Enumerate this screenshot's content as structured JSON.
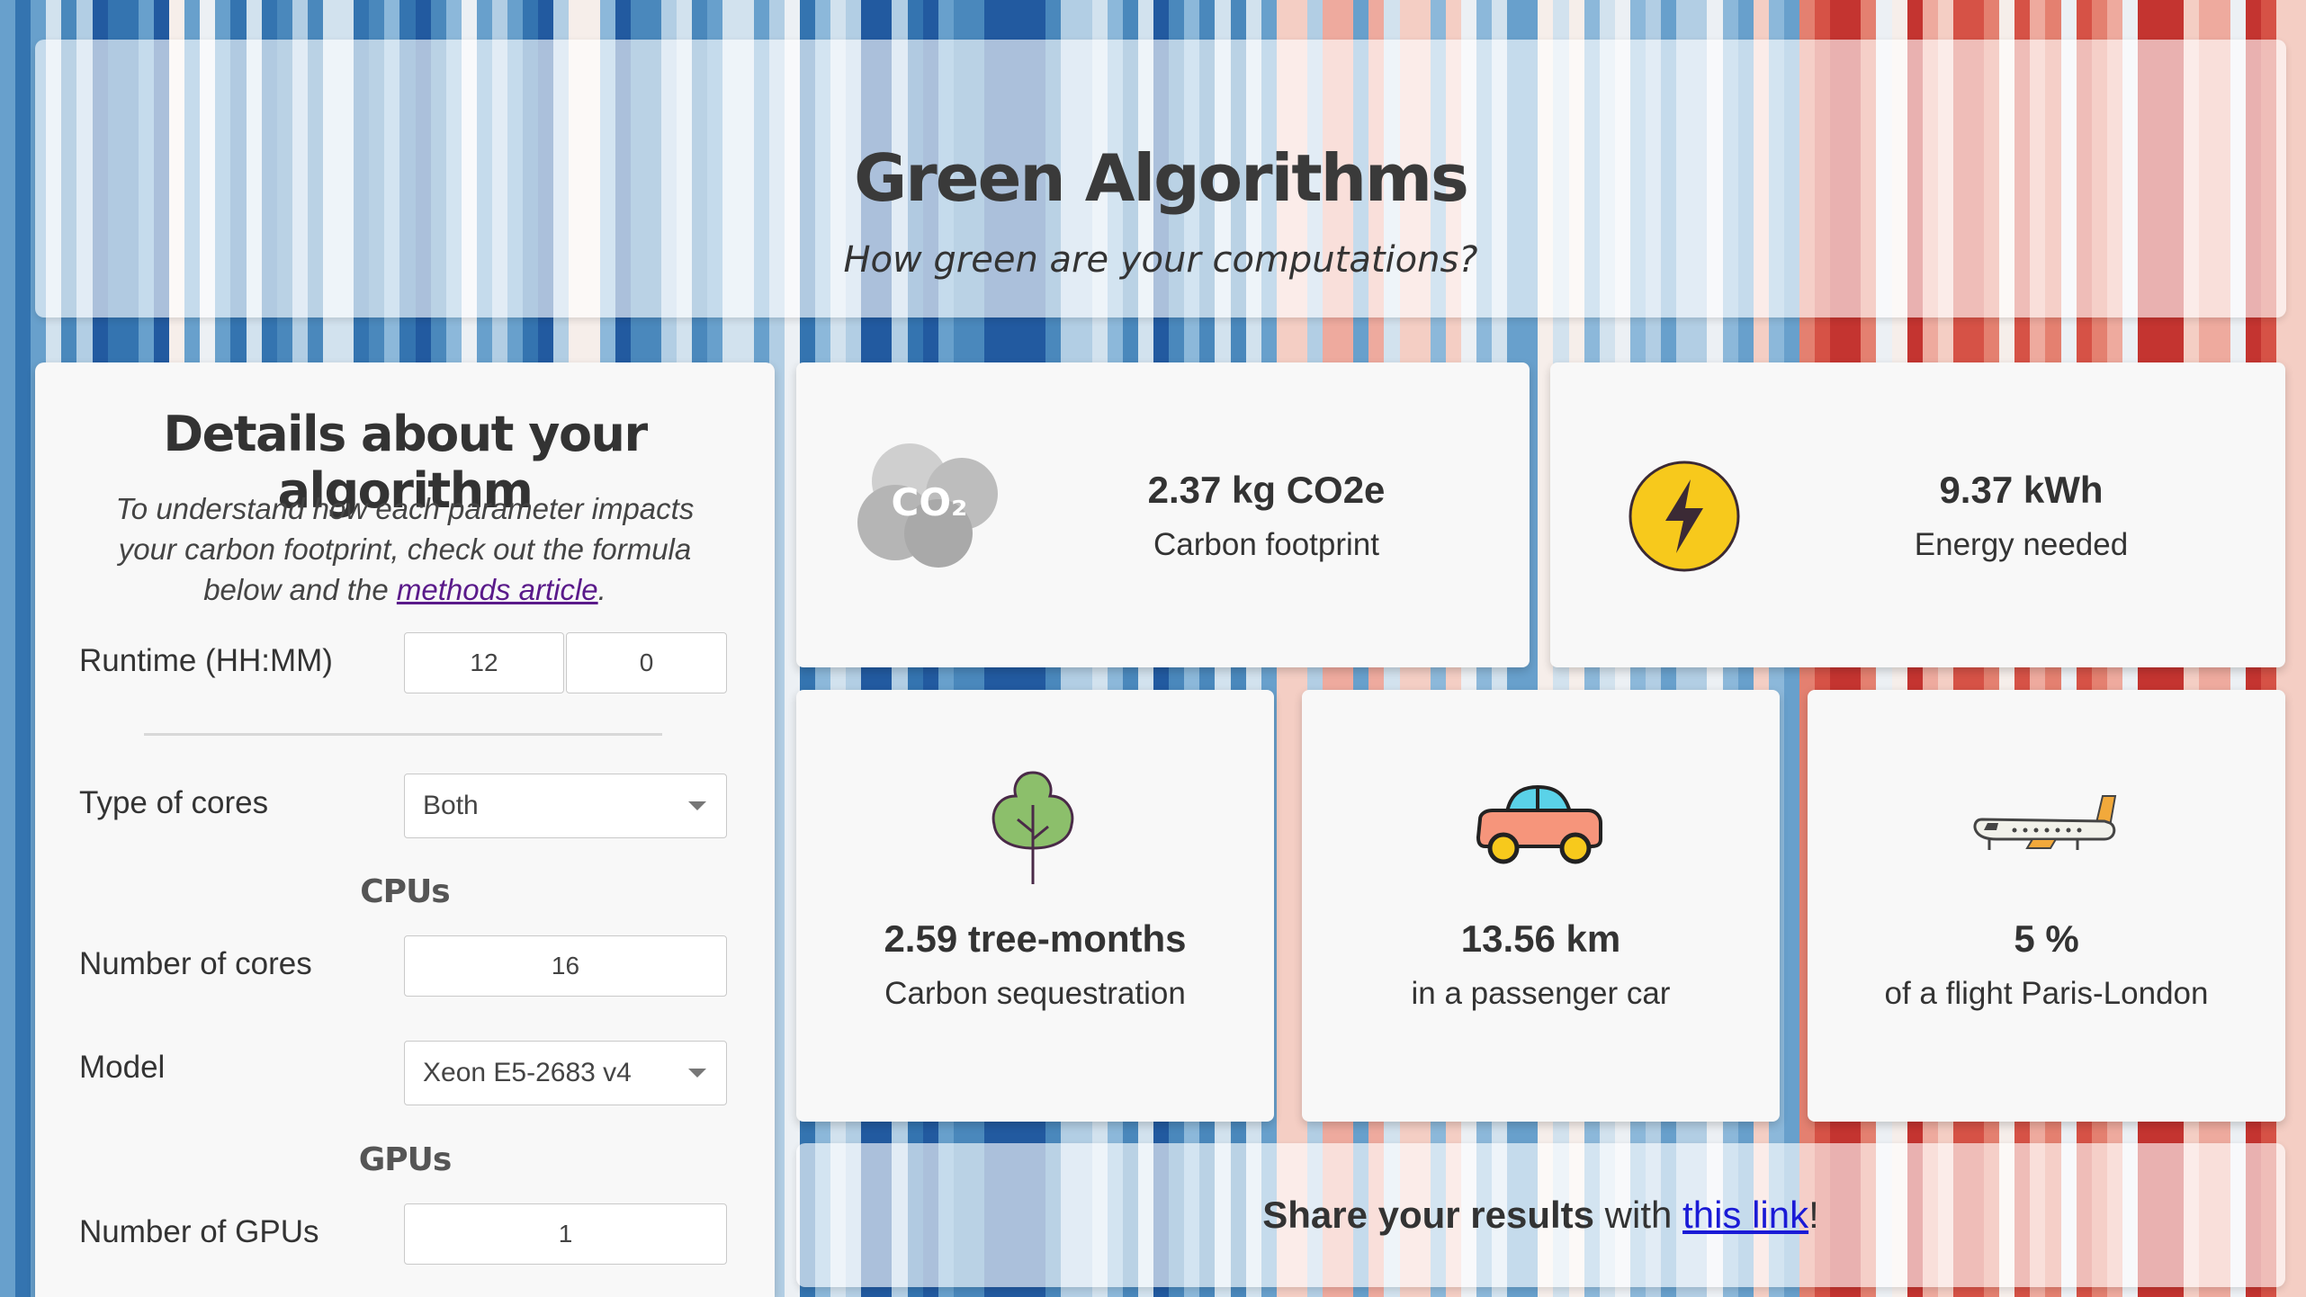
{
  "app": {
    "title": "Green Algorithms",
    "subtitle": "How green are your computations?"
  },
  "form": {
    "title": "Details about your algorithm",
    "intro_text": "To understand how each parameter impacts your carbon footprint, check out the formula below and the ",
    "intro_link": "methods article",
    "intro_end": ".",
    "runtime_label": "Runtime (HH:MM)",
    "runtime_hours": "12",
    "runtime_minutes": "0",
    "cores_type_label": "Type of cores",
    "cores_type_value": "Both",
    "cpu_section": "CPUs",
    "cpu_cores_label": "Number of cores",
    "cpu_cores_value": "16",
    "model_label": "Model",
    "model_value": "Xeon E5-2683 v4",
    "gpu_section": "GPUs",
    "gpu_count_label": "Number of GPUs",
    "gpu_count_value": "1"
  },
  "results": {
    "carbon": {
      "value": "2.37 kg CO2e",
      "label": "Carbon footprint",
      "icon": "co2-cloud-icon",
      "icon_text": "CO₂"
    },
    "energy": {
      "value": "9.37 kWh",
      "label": "Energy needed",
      "icon": "lightning-icon"
    },
    "trees": {
      "value": "2.59 tree-months",
      "label": "Carbon sequestration",
      "icon": "tree-icon"
    },
    "car": {
      "value": "13.56 km",
      "label": "in a passenger car",
      "icon": "car-icon"
    },
    "flight": {
      "value": "5 %",
      "label": "of a flight Paris-London",
      "icon": "airplane-icon"
    }
  },
  "share": {
    "bold": "Share your results",
    "mid": " with ",
    "link": "this link",
    "end": "!"
  },
  "colors": {
    "accent_link": "#1a1ad6",
    "visited_link": "#5a1a8a",
    "card_bg": "#f8f8f8",
    "energy_yellow": "#f7c91c",
    "tree_green": "#8cbf6b",
    "car_body": "#f6957b",
    "car_window": "#5ad2e8",
    "plane_tail": "#f2a93b",
    "stripe_cool": "#2f6aa5",
    "stripe_warm": "#d8473c"
  }
}
